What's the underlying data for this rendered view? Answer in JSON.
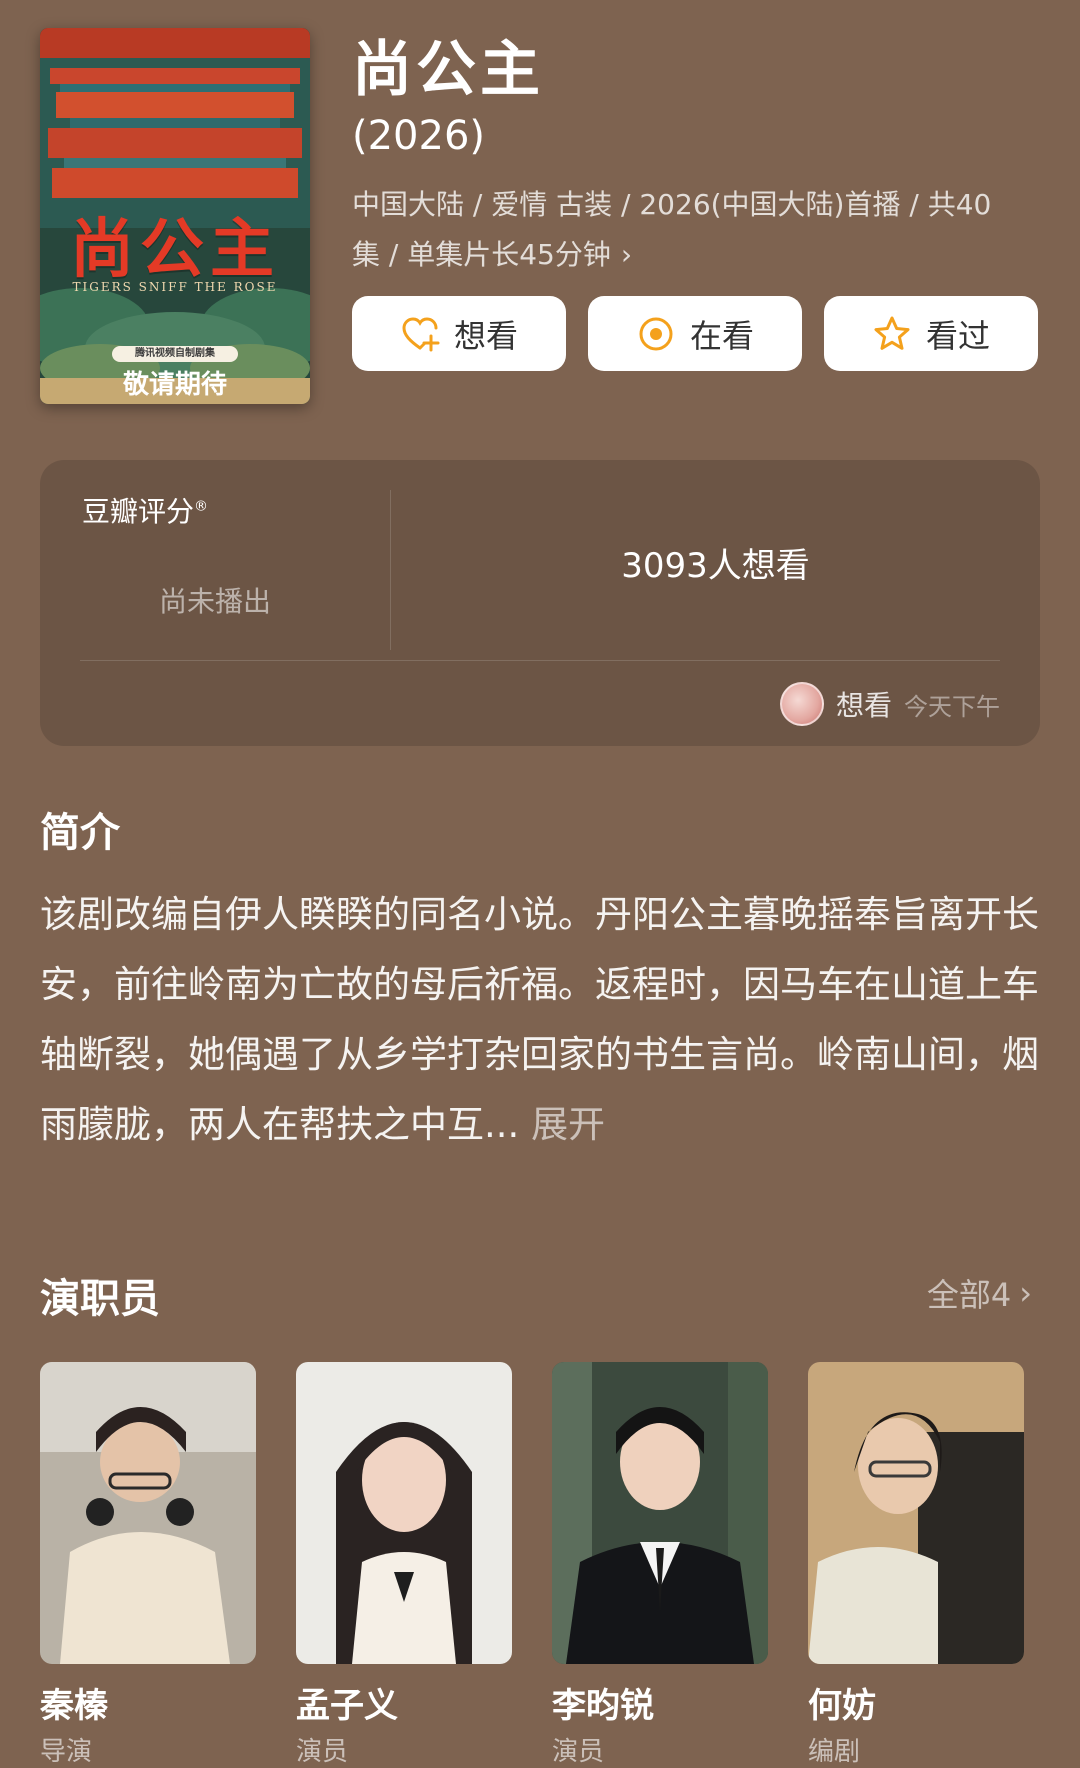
{
  "show": {
    "title": "尚公主",
    "year": "(2026)",
    "meta_line1": "中国大陆 / 爱情 古装 / 2026(中国大陆)首播 / 共40",
    "meta_line2": "集 / 单集片长45分钟",
    "meta_chevron": "›"
  },
  "poster": {
    "title_art": "尚公主",
    "subtitle": "TIGERS SNIFF THE ROSE",
    "producer_badge": "腾讯视频自制剧集",
    "tagline": "敬请期待"
  },
  "actions": {
    "want": "想看",
    "watching": "在看",
    "watched": "看过"
  },
  "rating": {
    "label": "豆瓣评分",
    "reg_mark": "®",
    "status": "尚未播出",
    "want_count": "3093人想看",
    "footer_action": "想看",
    "footer_time": "今天下午"
  },
  "intro": {
    "title": "简介",
    "text": "该剧改编自伊人睽睽的同名小说。丹阳公主暮晚摇奉旨离开长安，前往岭南为亡故的母后祈福。返程时，因马车在山道上车轴断裂，她偶遇了从乡学打杂回家的书生言尚。岭南山间，烟雨朦胧，两人在帮扶之中互...",
    "expand": "展开"
  },
  "cast": {
    "title": "演职员",
    "all": "全部4",
    "all_chevron": "›",
    "members": [
      {
        "name": "秦榛",
        "role": "导演"
      },
      {
        "name": "孟子义",
        "role": "演员"
      },
      {
        "name": "李昀锐",
        "role": "演员"
      },
      {
        "name": "何妨",
        "role": "编剧"
      }
    ]
  },
  "colors": {
    "background": "#7e6350",
    "card": "#6c5545",
    "accent_orange": "#f4a11c",
    "poster_red": "#e43a26"
  },
  "icons": {
    "want": "heart-plus-icon",
    "watching": "target-circle-icon",
    "watched": "star-outline-icon"
  }
}
